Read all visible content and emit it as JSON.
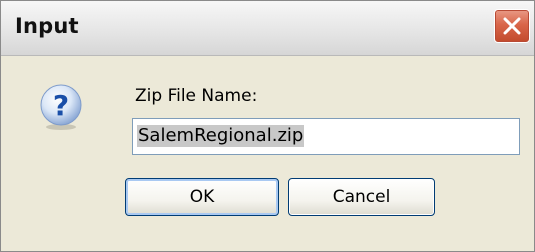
{
  "dialog": {
    "title": "Input",
    "prompt_label": "Zip File Name:",
    "input_value": "SalemRegional.zip",
    "ok_label": "OK",
    "cancel_label": "Cancel"
  },
  "icons": {
    "close": "close-icon",
    "question": "question-icon"
  },
  "colors": {
    "dialog_background": "#ece9d8",
    "close_button": "#d9664a",
    "question_icon": "#1a4fa8",
    "selection_highlight": "#c8c8c8",
    "button_border": "#003c74"
  }
}
